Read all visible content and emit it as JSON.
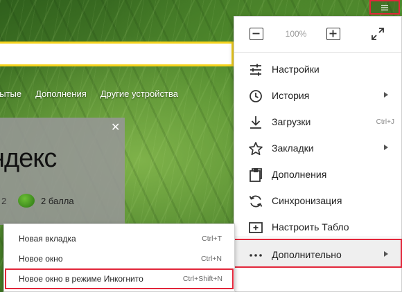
{
  "page": {
    "top_nav": [
      "рытые",
      "Дополнения",
      "Другие устройства"
    ]
  },
  "card": {
    "title": "ндекс",
    "close_glyph": "✕",
    "number": "2",
    "score": "2 балла"
  },
  "zoom": {
    "value": "100%"
  },
  "main_menu": {
    "items": [
      {
        "label": "Настройки",
        "icon": "settings-sliders-icon",
        "shortcut": "",
        "has_submenu": false
      },
      {
        "label": "История",
        "icon": "history-clock-icon",
        "shortcut": "",
        "has_submenu": true
      },
      {
        "label": "Загрузки",
        "icon": "download-icon",
        "shortcut": "Ctrl+J",
        "has_submenu": false
      },
      {
        "label": "Закладки",
        "icon": "bookmark-star-icon",
        "shortcut": "",
        "has_submenu": true
      },
      {
        "label": "Дополнения",
        "icon": "extensions-icon",
        "shortcut": "",
        "has_submenu": false
      },
      {
        "label": "Синхронизация",
        "icon": "sync-icon",
        "shortcut": "",
        "has_submenu": false
      },
      {
        "label": "Настроить Табло",
        "icon": "tableau-plus-icon",
        "shortcut": "",
        "has_submenu": false
      },
      {
        "label": "Дополнительно",
        "icon": "more-dots-icon",
        "shortcut": "",
        "has_submenu": true
      }
    ]
  },
  "submenu": {
    "items": [
      {
        "label": "Новая вкладка",
        "shortcut": "Ctrl+T"
      },
      {
        "label": "Новое окно",
        "shortcut": "Ctrl+N"
      },
      {
        "label": "Новое окно в режиме Инкогнито",
        "shortcut": "Ctrl+Shift+N"
      }
    ]
  },
  "colors": {
    "highlight": "#e2263a",
    "search_border": "#f6d31c",
    "menu_text": "#222222"
  }
}
